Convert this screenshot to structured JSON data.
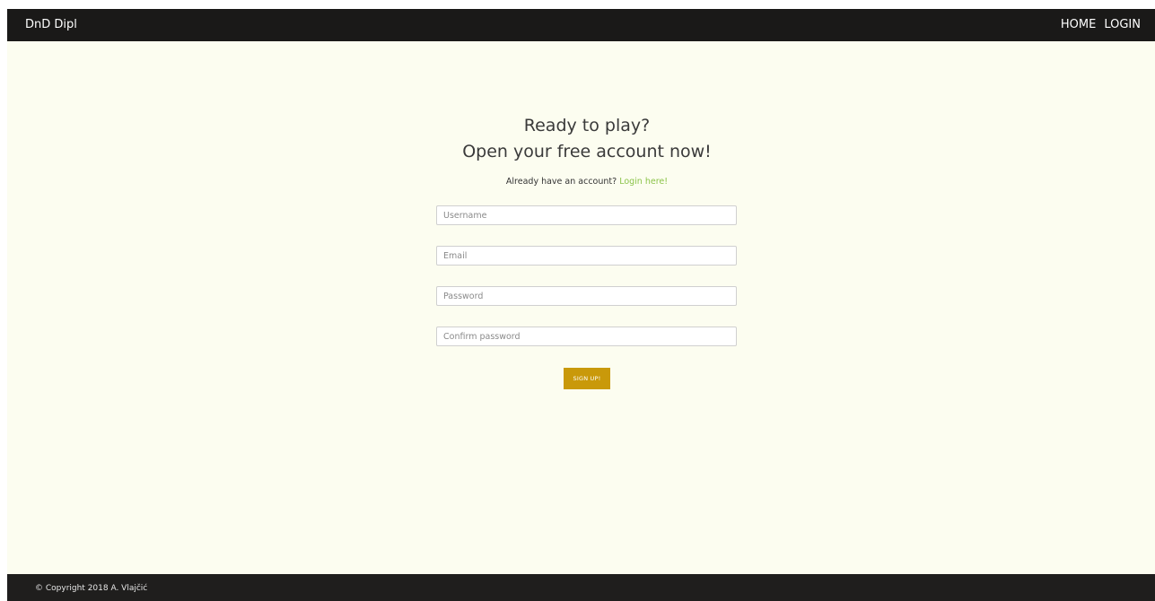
{
  "navbar": {
    "brand": "DnD Dipl",
    "links": [
      "HOME",
      "LOGIN"
    ]
  },
  "main": {
    "heading_line1": "Ready to play?",
    "heading_line2": "Open your free account now!",
    "already_text": "Already have an account?",
    "login_link": "Login here!",
    "fields": {
      "username_placeholder": "Username",
      "email_placeholder": "Email",
      "password_placeholder": "Password",
      "confirm_placeholder": "Confirm password"
    },
    "signup_label": "SIGN UP!"
  },
  "footer": {
    "copyright": "© Copyright 2018 A. Vlajčić"
  },
  "colors": {
    "navbar_bg": "#1a1918",
    "page_bg": "#fcfdf0",
    "accent_button": "#c9990a",
    "link_green": "#8bc34a"
  }
}
